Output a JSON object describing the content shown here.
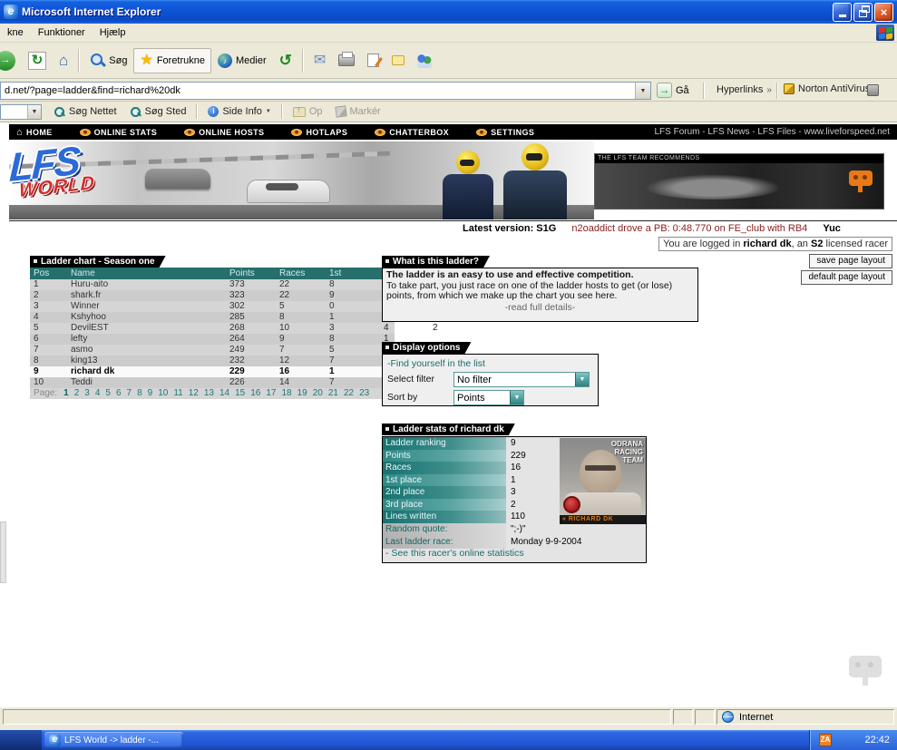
{
  "titlebar": {
    "title": "Microsoft Internet Explorer"
  },
  "menubar": {
    "items": [
      "kne",
      "Funktioner",
      "Hjælp"
    ]
  },
  "toolbar": {
    "search_label": "Søg",
    "favorites_label": "Foretrukne",
    "media_label": "Medier"
  },
  "addressbar": {
    "url": "d.net/?page=ladder&find=richard%20dk",
    "go_label": "Gå",
    "links_label": "Hyperlinks",
    "norton_label": "Norton AntiVirus"
  },
  "toolbar2": {
    "search_web": "Søg Nettet",
    "search_site": "Søg Sted",
    "side_info": "Side Info",
    "up": "Op",
    "mark": "Markér"
  },
  "site_nav": {
    "items": [
      "HOME",
      "ONLINE STATS",
      "ONLINE HOSTS",
      "HOTLAPS",
      "CHATTERBOX",
      "SETTINGS"
    ],
    "right_links": "LFS Forum - LFS News - LFS Files - www.liveforspeed.net"
  },
  "banner": {
    "logo_top": "LFS",
    "logo_bottom": "WORLD",
    "ad_label": "THE LFS TEAM RECOMMENDS"
  },
  "ticker": {
    "latest_version": "Latest version: S1G",
    "pb_text": "n2oaddict drove a PB: 0:48.770 on FE_club with RB4",
    "next_partial": "Yuc"
  },
  "login": {
    "prefix": "You are logged in ",
    "user": "richard dk",
    "middle": ", an ",
    "license": "S2",
    "suffix": " licensed racer"
  },
  "layout_buttons": {
    "save": "save page layout",
    "default": "default page layout"
  },
  "ladder": {
    "title": "Ladder chart - Season one",
    "headers": [
      "Pos",
      "Name",
      "Points",
      "Races",
      "1st"
    ],
    "rows": [
      {
        "pos": "1",
        "name": "Huru-aito",
        "points": "373",
        "races": "22",
        "first": "8"
      },
      {
        "pos": "2",
        "name": "shark.fr",
        "points": "323",
        "races": "22",
        "first": "9"
      },
      {
        "pos": "3",
        "name": "Winner",
        "points": "302",
        "races": "5",
        "first": "0"
      },
      {
        "pos": "4",
        "name": "Kshyhoo",
        "points": "285",
        "races": "8",
        "first": "1"
      },
      {
        "pos": "5",
        "name": "DevilEST",
        "points": "268",
        "races": "10",
        "first": "3"
      },
      {
        "pos": "6",
        "name": "lefty",
        "points": "264",
        "races": "9",
        "first": "8"
      },
      {
        "pos": "7",
        "name": "asmo",
        "points": "249",
        "races": "7",
        "first": "5"
      },
      {
        "pos": "8",
        "name": "king13",
        "points": "232",
        "races": "12",
        "first": "7"
      },
      {
        "pos": "9",
        "name": "richard dk",
        "points": "229",
        "races": "16",
        "first": "1",
        "highlight": true
      },
      {
        "pos": "10",
        "name": "Teddi",
        "points": "226",
        "races": "14",
        "first": "7"
      }
    ],
    "page_label": "Page:",
    "pages": [
      "1",
      "2",
      "3",
      "4",
      "5",
      "6",
      "7",
      "8",
      "9",
      "10",
      "11",
      "12",
      "13",
      "14",
      "15",
      "16",
      "17",
      "18",
      "19",
      "20",
      "21",
      "22",
      "23"
    ],
    "current_page": "1"
  },
  "what_is_ladder": {
    "title": "What is this ladder?",
    "intro": "The ladder is an easy to use and effective competition.",
    "body": "To take part, you just race on one of the ladder hosts to get (or lose) points, from which we make up the chart you see here.",
    "link": "-read full details-",
    "stray_values": [
      "4",
      "2",
      "1"
    ]
  },
  "display_options": {
    "title": "Display options",
    "find_link": "-Find yourself in the list",
    "filter_label": "Select filter",
    "filter_value": "No filter",
    "sort_label": "Sort by",
    "sort_value": "Points"
  },
  "ladder_stats": {
    "title": "Ladder stats of richard dk",
    "rows": [
      {
        "label": "Ladder ranking",
        "value": "9"
      },
      {
        "label": "Points",
        "value": "229"
      },
      {
        "label": "Races",
        "value": "16"
      },
      {
        "label": "1st place",
        "value": "1"
      },
      {
        "label": "2nd place",
        "value": "3"
      },
      {
        "label": "3rd place",
        "value": "2"
      },
      {
        "label": "Lines written",
        "value": "110"
      },
      {
        "label": "Random quote:",
        "value": "\";-)\""
      },
      {
        "label": "Last ladder race:",
        "value": "Monday 9-9-2004"
      }
    ],
    "link": "- See this racer's online statistics",
    "photo": {
      "team_lines": [
        "ODRANA",
        "RACING",
        "TEAM"
      ],
      "caption": "RICHARD DK"
    }
  },
  "statusbar": {
    "zone": "Internet"
  },
  "taskbar": {
    "task_label": "LFS World -> ladder -...",
    "tray_icon": "ZA",
    "clock": "22:42"
  },
  "icons": {
    "ie_logo": "e",
    "close": "×",
    "dropdown_arrow": "▼",
    "chevron_double": "»",
    "go_arrow": "→",
    "forward_arrow": "→",
    "home_glyph": "⌂",
    "refresh_glyph": "↻",
    "history_glyph": "↺",
    "mail_glyph": "✉",
    "star_glyph": "★",
    "note_glyph": "♪",
    "info_glyph": "i",
    "caption_arrows": "«"
  },
  "colors": {
    "teal_accent": "#1d7a78",
    "section_bar": "#000000",
    "xp_blue": "#245edc",
    "pb_text": "#8b2020"
  }
}
